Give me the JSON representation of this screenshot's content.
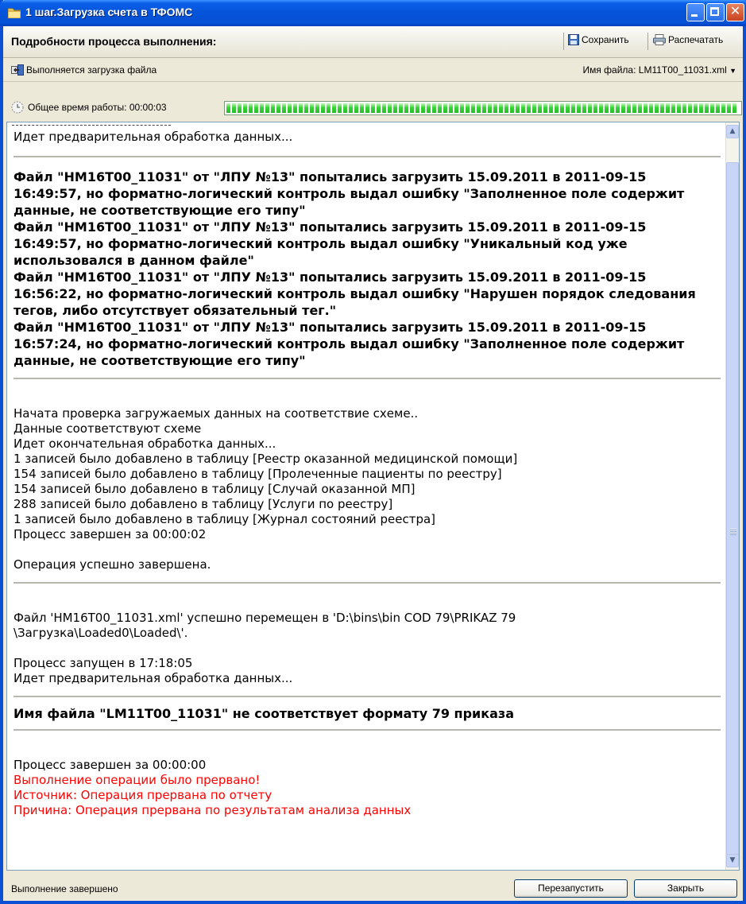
{
  "window": {
    "title": "1 шаг.Загрузка счета в ТФОМС"
  },
  "toolbar": {
    "details_label": "Подробности процесса выполнения:",
    "save_label": "Сохранить",
    "print_label": "Распечатать"
  },
  "status_row": {
    "status_text": "Выполняется загрузка файла",
    "filename_label": "Имя файла:",
    "filename_value": "LM11T00_11031.xml"
  },
  "timer": {
    "label": "Общее время работы: 00:00:03",
    "progress_percent": 100
  },
  "log": {
    "line_preprocess_1": "Идет предварительная обработка данных...",
    "errors_1": "Файл \"HM16T00_11031\" от \"ЛПУ №13\" попытались загрузить 15.09.2011 в 2011-09-15 16:49:57, но форматно-логический контроль выдал ошибку \"Заполненное поле содержит данные, не соответствующие его типу\"\nФайл \"HM16T00_11031\" от \"ЛПУ №13\" попытались загрузить 15.09.2011 в 2011-09-15 16:49:57, но форматно-логический контроль выдал ошибку \"Уникальный код уже использовался в данном файле\"\nФайл \"HM16T00_11031\" от \"ЛПУ №13\" попытались загрузить 15.09.2011 в 2011-09-15 16:56:22, но форматно-логический контроль выдал ошибку \"Нарушен порядок следования тегов, либо отсутствует обязательный тег.\"\nФайл \"HM16T00_11031\" от \"ЛПУ №13\" попытались загрузить 15.09.2011 в 2011-09-15 16:57:24, но форматно-логический контроль выдал ошибку \"Заполненное поле содержит данные, не соответствующие его типу\"",
    "block_2": "Начата проверка загружаемых данных на соответствие схеме..\nДанные соответствуют схеме\nИдет окончательная обработка данных...\n1 записей было добавлено в таблицу [Реестр оказанной медицинской помощи]\n154 записей было добавлено в таблицу [Пролеченные пациенты по реестру]\n154 записей было добавлено в таблицу [Случай оказанной МП]\n288 записей было добавлено в таблицу [Услуги по реестру]\n1 записей было добавлено в таблицу [Журнал состояний реестра]\nПроцесс завершен за 00:00:02\n\nОперация успешно завершена.",
    "block_3": "Файл 'HM16T00_11031.xml' успешно перемещен в 'D:\\bins\\bin COD 79\\PRIKAZ 79\n\\Загрузка\\Loaded0\\Loaded\\'.\n\nПроцесс запущен в 17:18:05\nИдет предварительная обработка данных...",
    "error_2": "Имя файла \"LM11T00_11031\" не соответствует формату 79 приказа",
    "finish_line": "Процесс завершен за 00:00:00",
    "red_lines": "Выполнение операции было прервано!\nИсточник: Операция прервана по отчету\nПричина: Операция прервана по результатам анализа данных"
  },
  "footer": {
    "state_text": "Выполнение завершено",
    "restart_label": "Перезапустить",
    "close_label": "Закрыть"
  },
  "colors": {
    "titlebar": "#0553d9",
    "error_text": "#ff0000",
    "progress": "#37d537"
  },
  "icons": [
    "folder-icon",
    "minimize-icon",
    "maximize-icon",
    "close-icon",
    "save-icon",
    "print-icon",
    "loading-icon",
    "clock-icon",
    "dropdown-arrow-icon",
    "scroll-up-icon",
    "scroll-down-icon"
  ]
}
